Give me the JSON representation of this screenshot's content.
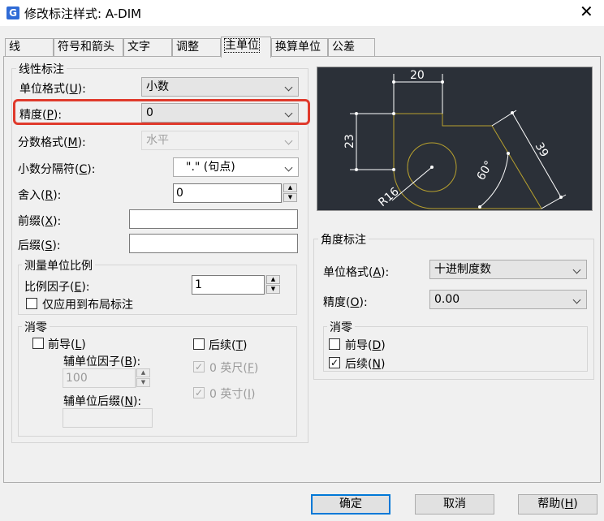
{
  "window": {
    "title": "修改标注样式: A-DIM",
    "app_icon_letter": "G",
    "close_glyph": "✕"
  },
  "tabs": [
    "线",
    "符号和箭头",
    "文字",
    "调整",
    "主单位",
    "换算单位",
    "公差"
  ],
  "active_tab": "主单位",
  "linear": {
    "group_title": "线性标注",
    "unit_format": {
      "label": "单位格式",
      "key": "U",
      "value": "小数"
    },
    "precision": {
      "label": "精度",
      "key": "P",
      "value": "0"
    },
    "fraction_format": {
      "label": "分数格式",
      "key": "M",
      "value": "水平"
    },
    "decimal_separator": {
      "label": "小数分隔符",
      "key": "C",
      "value": "\".\" (句点)"
    },
    "round_off": {
      "label": "舍入",
      "key": "R",
      "value": "0"
    },
    "prefix": {
      "label": "前缀",
      "key": "X",
      "value": ""
    },
    "suffix": {
      "label": "后缀",
      "key": "S",
      "value": ""
    }
  },
  "scale": {
    "group_title": "测量单位比例",
    "factor": {
      "label": "比例因子",
      "key": "E",
      "value": "1"
    },
    "layout_only": {
      "label": "仅应用到布局标注",
      "checked": false
    }
  },
  "zero_suppression": {
    "group_title": "消零",
    "leading": {
      "label": "前导",
      "key": "L",
      "checked": false
    },
    "trailing": {
      "label": "后续",
      "key": "T",
      "checked": false
    },
    "sub_unit_factor": {
      "label": "辅单位因子",
      "key": "B",
      "value": "100"
    },
    "sub_unit_suffix": {
      "label": "辅单位后缀",
      "key": "N",
      "value": ""
    },
    "feet": {
      "label": "0 英尺",
      "key": "F",
      "checked": true
    },
    "inches": {
      "label": "0 英寸",
      "key": "I",
      "checked": true
    }
  },
  "angular": {
    "group_title": "角度标注",
    "unit_format": {
      "label": "单位格式",
      "key": "A",
      "value": "十进制度数"
    },
    "precision": {
      "label": "精度",
      "key": "O",
      "value": "0.00"
    },
    "zero_group_title": "消零",
    "leading": {
      "label": "前导",
      "key": "D",
      "checked": false
    },
    "trailing": {
      "label": "后续",
      "key": "N",
      "checked": true
    }
  },
  "preview": {
    "dims": [
      "20",
      "23",
      "39",
      "60°",
      "R16"
    ],
    "line_color": "#b8a12e",
    "dim_color": "#ffffff"
  },
  "buttons": {
    "ok": "确定",
    "cancel": "取消",
    "help": "帮助",
    "help_key": "H"
  }
}
